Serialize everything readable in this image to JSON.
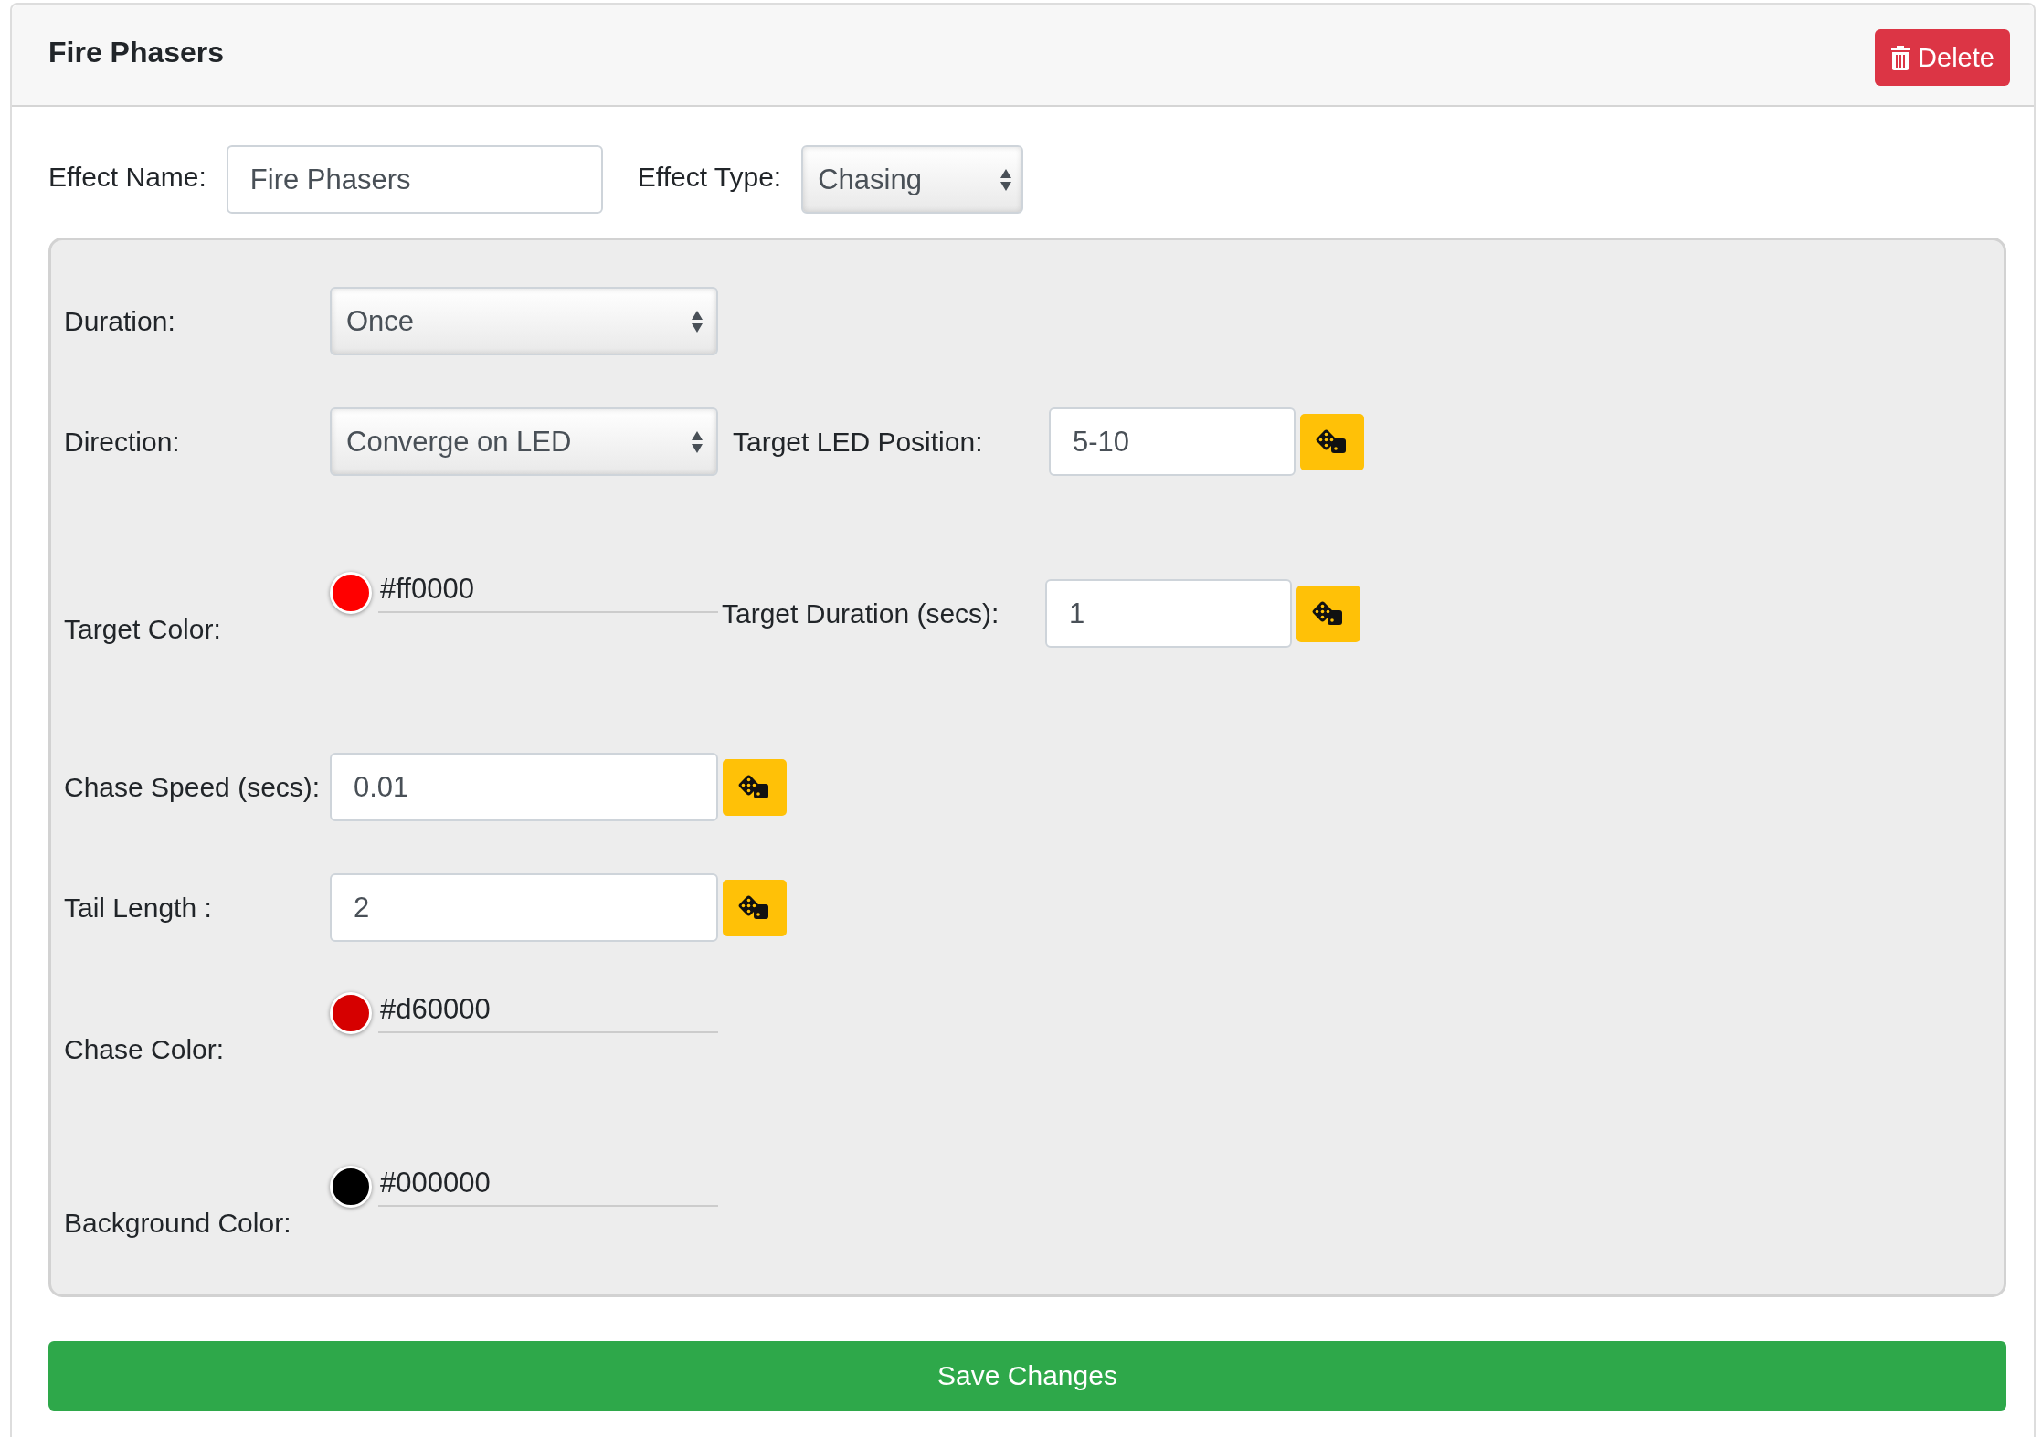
{
  "header": {
    "title": "Fire Phasers",
    "delete_button": "Delete"
  },
  "effect": {
    "name_label": "Effect Name:",
    "name_value": "Fire Phasers",
    "type_label": "Effect Type:",
    "type_value": "Chasing"
  },
  "settings": [
    {
      "label": "Duration:",
      "kind": "select",
      "value": "Once"
    },
    {
      "label": "Direction:",
      "kind": "select",
      "value": "Converge on LED",
      "side": {
        "label": "Target LED Position:",
        "value": "5-10"
      }
    },
    {
      "label": "Target Color:",
      "kind": "color",
      "value": "#ff0000",
      "color": "#ff0000",
      "side": {
        "label": "Target Duration (secs):",
        "value": "1"
      }
    },
    {
      "label": "Chase Speed (secs):",
      "kind": "input",
      "value": "0.01"
    },
    {
      "label": "Tail Length :",
      "kind": "input",
      "value": "2"
    },
    {
      "label": "Chase Color:",
      "kind": "color",
      "value": "#d60000",
      "color": "#d60000"
    },
    {
      "label": "Background Color:",
      "kind": "color",
      "value": "#000000",
      "color": "#000000"
    }
  ],
  "save_button": "Save Changes"
}
